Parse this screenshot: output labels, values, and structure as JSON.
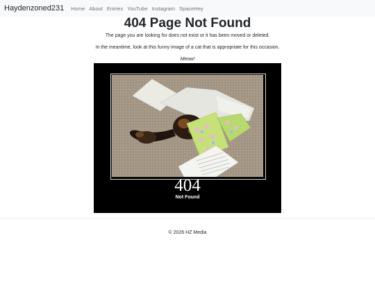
{
  "navbar": {
    "brand": "Haydenzoned231",
    "links": [
      "Home",
      "About",
      "Entries",
      "YouTube",
      "Instagram",
      "SpaceHey"
    ]
  },
  "main": {
    "title": "404 Page Not Found",
    "message": "The page you are looking for does not exist or it has been moved or deleted.",
    "meantime": "In the meantime, look at this funny image of a cat that is appropriate for this occasion.",
    "caption": "Meow!"
  },
  "poster": {
    "title": "404",
    "subtitle": "Not Found"
  },
  "footer": {
    "copyright": "© 2026 HZ Media"
  },
  "colors": {
    "navbar_bg": "#f8f9fa",
    "nav_link": "#6c757d",
    "poster_bg": "#000000",
    "text": "#212529"
  }
}
